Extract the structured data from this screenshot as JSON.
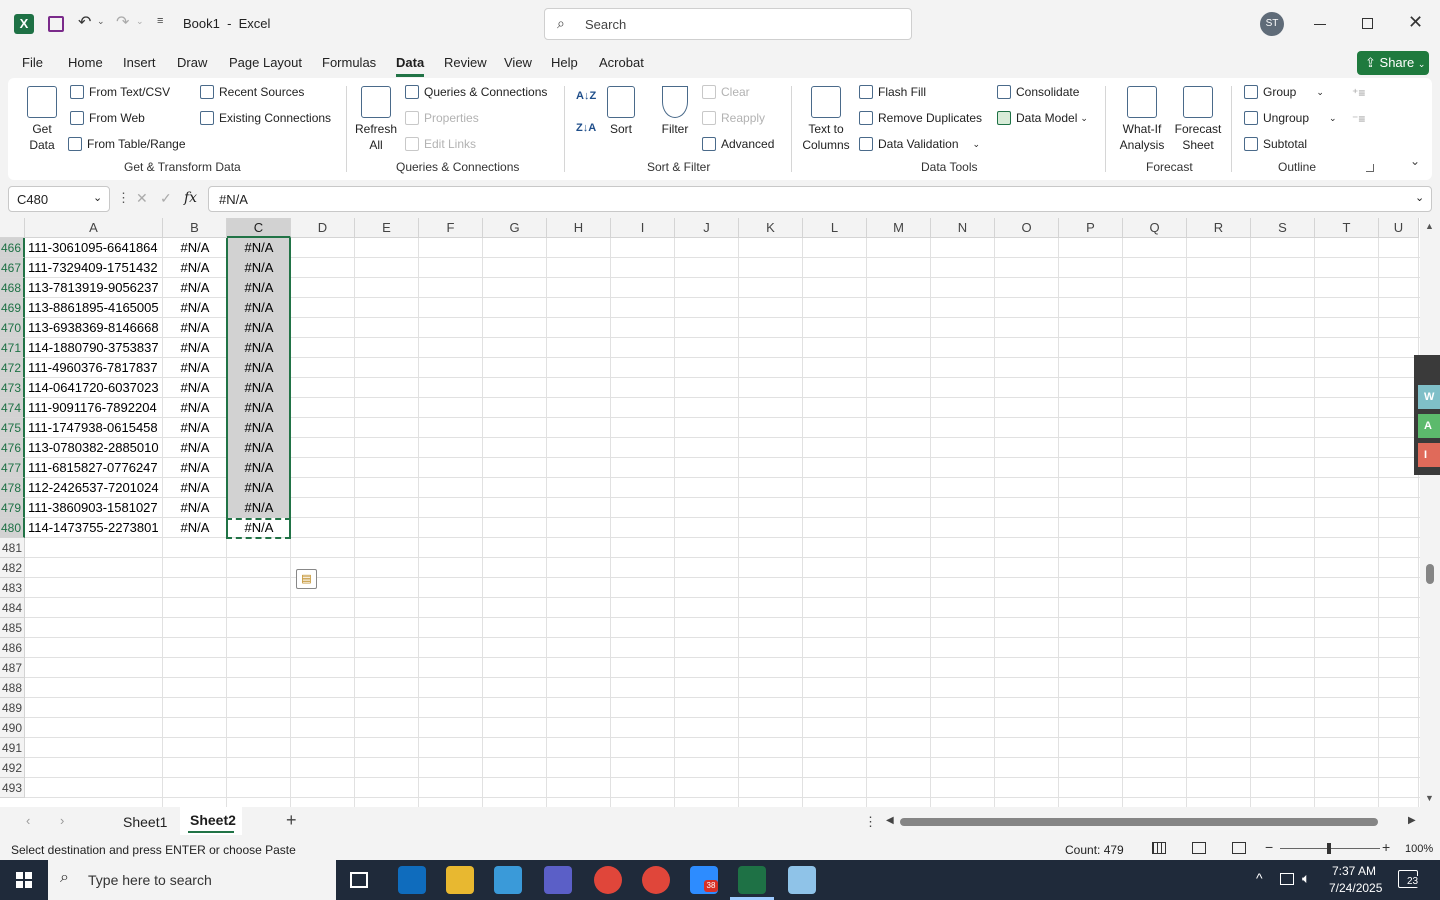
{
  "titlebar": {
    "doc_title": "Book1  -  Excel",
    "search_placeholder": "Search",
    "avatar": "ST",
    "share": "Share"
  },
  "menu": [
    "File",
    "Home",
    "Insert",
    "Draw",
    "Page Layout",
    "Formulas",
    "Data",
    "Review",
    "View",
    "Help",
    "Acrobat"
  ],
  "ribbon": {
    "get_data": "Get\nData",
    "from_text": "From Text/CSV",
    "from_web": "From Web",
    "from_table": "From Table/Range",
    "recent_sources": "Recent Sources",
    "existing_connections": "Existing Connections",
    "group_get": "Get & Transform Data",
    "refresh_all": "Refresh\nAll",
    "queries_connections": "Queries & Connections",
    "properties": "Properties",
    "edit_links": "Edit Links",
    "group_queries": "Queries & Connections",
    "sort": "Sort",
    "filter": "Filter",
    "clear": "Clear",
    "reapply": "Reapply",
    "advanced": "Advanced",
    "group_sort": "Sort & Filter",
    "text_to_columns": "Text to\nColumns",
    "flash_fill": "Flash Fill",
    "remove_duplicates": "Remove Duplicates",
    "data_validation": "Data Validation",
    "consolidate": "Consolidate",
    "data_model": "Data Model",
    "group_tools": "Data Tools",
    "what_if": "What-If\nAnalysis",
    "forecast_sheet": "Forecast\nSheet",
    "group_forecast": "Forecast",
    "group_btn": "Group",
    "ungroup": "Ungroup",
    "subtotal": "Subtotal",
    "group_outline": "Outline"
  },
  "formula_bar": {
    "name_box": "C480",
    "fx": "fx",
    "value": "#N/A"
  },
  "columns": [
    "A",
    "B",
    "C",
    "D",
    "E",
    "F",
    "G",
    "H",
    "I",
    "J",
    "K",
    "L",
    "M",
    "N",
    "O",
    "P",
    "Q",
    "R",
    "S",
    "T",
    "U"
  ],
  "rows": [
    {
      "n": "466",
      "a": "111-3061095-6641864",
      "b": "#N/A",
      "c": "#N/A"
    },
    {
      "n": "467",
      "a": "111-7329409-1751432",
      "b": "#N/A",
      "c": "#N/A"
    },
    {
      "n": "468",
      "a": "113-7813919-9056237",
      "b": "#N/A",
      "c": "#N/A"
    },
    {
      "n": "469",
      "a": "113-8861895-4165005",
      "b": "#N/A",
      "c": "#N/A"
    },
    {
      "n": "470",
      "a": "113-6938369-8146668",
      "b": "#N/A",
      "c": "#N/A"
    },
    {
      "n": "471",
      "a": "114-1880790-3753837",
      "b": "#N/A",
      "c": "#N/A"
    },
    {
      "n": "472",
      "a": "111-4960376-7817837",
      "b": "#N/A",
      "c": "#N/A"
    },
    {
      "n": "473",
      "a": "114-0641720-6037023",
      "b": "#N/A",
      "c": "#N/A"
    },
    {
      "n": "474",
      "a": "111-9091176-7892204",
      "b": "#N/A",
      "c": "#N/A"
    },
    {
      "n": "475",
      "a": "111-1747938-0615458",
      "b": "#N/A",
      "c": "#N/A"
    },
    {
      "n": "476",
      "a": "113-0780382-2885010",
      "b": "#N/A",
      "c": "#N/A"
    },
    {
      "n": "477",
      "a": "111-6815827-0776247",
      "b": "#N/A",
      "c": "#N/A"
    },
    {
      "n": "478",
      "a": "112-2426537-7201024",
      "b": "#N/A",
      "c": "#N/A"
    },
    {
      "n": "479",
      "a": "111-3860903-1581027",
      "b": "#N/A",
      "c": "#N/A"
    },
    {
      "n": "480",
      "a": "114-1473755-2273801",
      "b": "#N/A",
      "c": "#N/A"
    },
    {
      "n": "481",
      "a": "",
      "b": "",
      "c": ""
    },
    {
      "n": "482",
      "a": "",
      "b": "",
      "c": ""
    },
    {
      "n": "483",
      "a": "",
      "b": "",
      "c": ""
    },
    {
      "n": "484",
      "a": "",
      "b": "",
      "c": ""
    },
    {
      "n": "485",
      "a": "",
      "b": "",
      "c": ""
    },
    {
      "n": "486",
      "a": "",
      "b": "",
      "c": ""
    },
    {
      "n": "487",
      "a": "",
      "b": "",
      "c": ""
    },
    {
      "n": "488",
      "a": "",
      "b": "",
      "c": ""
    },
    {
      "n": "489",
      "a": "",
      "b": "",
      "c": ""
    },
    {
      "n": "490",
      "a": "",
      "b": "",
      "c": ""
    },
    {
      "n": "491",
      "a": "",
      "b": "",
      "c": ""
    },
    {
      "n": "492",
      "a": "",
      "b": "",
      "c": ""
    },
    {
      "n": "493",
      "a": "",
      "b": "",
      "c": ""
    }
  ],
  "sheets": [
    "Sheet1",
    "Sheet2"
  ],
  "active_sheet": "Sheet2",
  "status": {
    "message": "Select destination and press ENTER or choose Paste",
    "count": "Count: 479",
    "zoom": "100%"
  },
  "taskbar": {
    "search": "Type here to search",
    "time": "7:37 AM",
    "date": "7/24/2025",
    "notif": "23",
    "zoom_badge": "38"
  },
  "colors": {
    "excel_green": "#1e7145",
    "share_green": "#1f7a3e",
    "selection": "#d2d2d2",
    "accent": "#217346"
  }
}
